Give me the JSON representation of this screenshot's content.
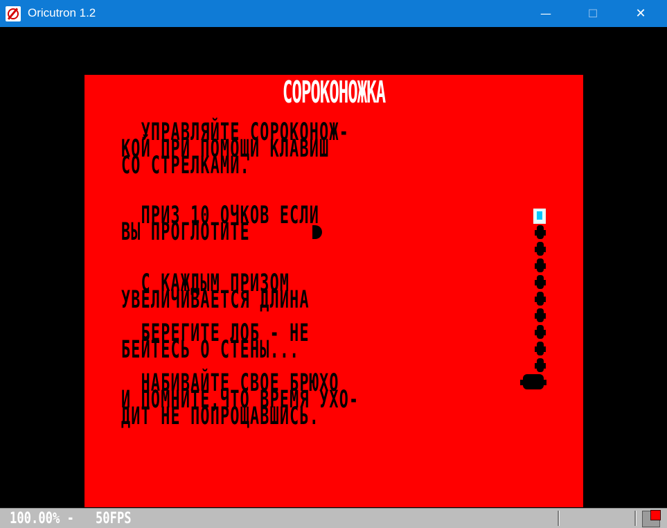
{
  "window": {
    "title": "Oricutron 1.2",
    "minimize": "—",
    "maximize": "☐",
    "close": "✕"
  },
  "screen": {
    "background": "#ff0000",
    "heading": "СОРОКОНОЖКА",
    "lines": [
      "  УПРАВЛЯЙТЕ СОРОКОНОЖ-",
      "КОЙ ПРИ ПОМОЩИ КЛАВИШ",
      "СО СТРЕЛКАМИ.",
      "  ПРИЗ 10 ОЧКОВ ЕСЛИ",
      "ВЫ ПРОГЛОТИТЕ",
      "  С КАЖДЫМ ПРИЗОМ",
      "УВЕЛИЧИВАЕТСЯ ДЛИНА",
      "  БЕРЕГИТЕ ЛОБ - НЕ",
      "БЕЙТЕСЬ О СТЕНЫ...",
      "  НАБИВАЙТЕ СВОЕ БРЮХО",
      "И ПОМНИТЕ,ЧТО ВРЕМЯ УХО-",
      "ДИТ НЕ ПОПРОЩАВШИСЬ."
    ]
  },
  "status": {
    "text": "100.00% -   50FPS"
  },
  "icons": {
    "app": "oricutron-logo-icon",
    "disk": "disk-activity-icon",
    "led_color": "#ff0000"
  }
}
